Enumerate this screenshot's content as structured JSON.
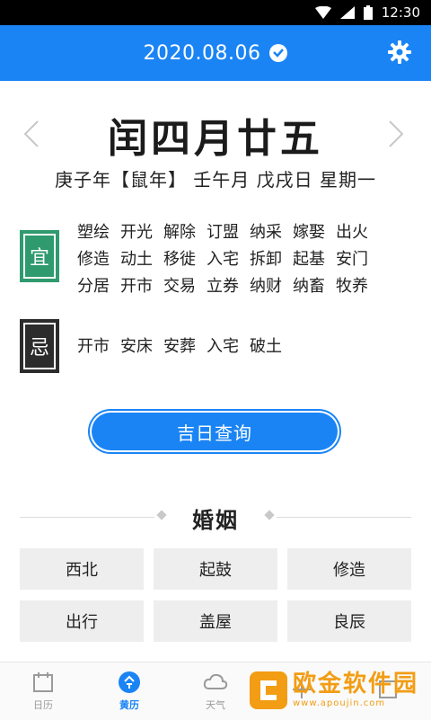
{
  "status_bar": {
    "time": "12:30",
    "icons": [
      "wifi-icon",
      "signal-icon",
      "battery-icon"
    ]
  },
  "header": {
    "date": "2020.08.06",
    "settings_icon": "gear-icon",
    "accent": "#1a84f5"
  },
  "lunar": {
    "title": "闰四月廿五",
    "ganzhi": "庚子年【鼠年】 壬午月 戊戌日 星期一"
  },
  "yi": {
    "label": "宜",
    "color": "#2e9a6e",
    "rows": [
      [
        "塑绘",
        "开光",
        "解除",
        "订盟",
        "纳采",
        "嫁娶",
        "出火"
      ],
      [
        "修造",
        "动土",
        "移徙",
        "入宅",
        "拆卸",
        "起基",
        "安门"
      ],
      [
        "分居",
        "开市",
        "交易",
        "立券",
        "纳财",
        "纳畜",
        "牧养"
      ]
    ]
  },
  "ji": {
    "label": "忌",
    "color": "#2c2c2c",
    "items": [
      "开市",
      "安床",
      "安葬",
      "入宅",
      "破土"
    ]
  },
  "button": {
    "label": "吉日查询"
  },
  "section": {
    "title": "婚姻",
    "cells": [
      "西北",
      "起鼓",
      "修造",
      "出行",
      "盖屋",
      "良辰"
    ]
  },
  "bottom_nav": [
    {
      "label": "日历",
      "icon": "calendar-icon",
      "active": false
    },
    {
      "label": "黄历",
      "icon": "almanac-icon",
      "active": true
    },
    {
      "label": "天气",
      "icon": "cloud-icon",
      "active": false
    },
    {
      "label": "",
      "icon": "plus-icon",
      "active": false
    },
    {
      "label": "",
      "icon": "profile-icon",
      "active": false
    }
  ],
  "watermark": {
    "main": "欧金软件园",
    "sub": "www.apoujin.com"
  }
}
